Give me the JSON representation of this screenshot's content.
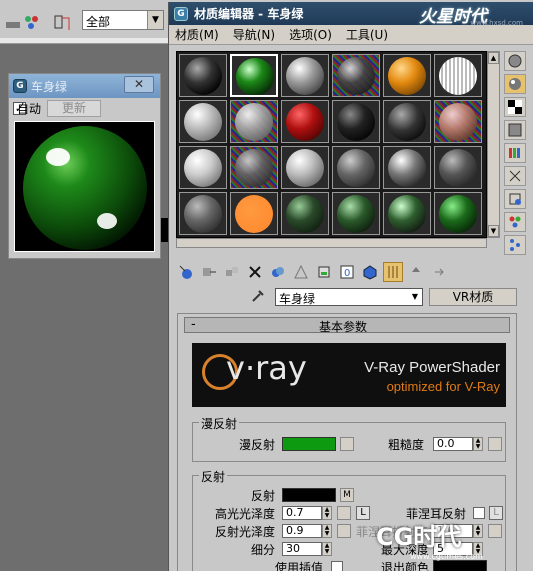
{
  "background": {
    "dropdown_value": "全部"
  },
  "preview_window": {
    "title": "车身绿",
    "auto_label": "自动",
    "update_label": "更新",
    "auto_checked": "✓"
  },
  "material_editor": {
    "title": "材质编辑器 - 车身绿",
    "menu": [
      "材质(M)",
      "导航(N)",
      "选项(O)",
      "工具(U)"
    ],
    "material_name": "车身绿",
    "material_type": "VR材质",
    "rollout_title": "基本参数",
    "vray_banner": {
      "logo": "v·ray",
      "line1": "V-Ray PowerShader",
      "line2": "optimized for V-Ray"
    },
    "diffuse": {
      "group": "漫反射",
      "label": "漫反射",
      "color": "#0e9a10",
      "roughness_label": "粗糙度",
      "roughness": "0.0"
    },
    "reflection": {
      "group": "反射",
      "label": "反射",
      "color": "#000000",
      "map_tag": "M",
      "highlight_gloss_label": "高光光泽度",
      "highlight_gloss": "0.7",
      "l_tag": "L",
      "fresnel_label": "菲涅耳反射",
      "fresnel_l": "L",
      "refl_gloss_label": "反射光泽度",
      "refl_gloss": "0.9",
      "fresnel_ior_label": "菲涅耳折射率",
      "fresnel_ior": "1.6",
      "subdivs_label": "细分",
      "subdivs": "30",
      "max_depth_label": "最大深度",
      "max_depth": "5",
      "use_interp_label": "使用插值",
      "exit_color_label": "退出颜色"
    }
  },
  "watermarks": {
    "top_logo": "火星时代",
    "top_url": "www.hxsd.com",
    "bottom_logo": "CG时代",
    "bottom_url": "www.cgtimes.com"
  },
  "colors": {
    "title_bar": "#1f3a56",
    "vray_orange": "#e07a16",
    "body_green": "#0e9a10"
  }
}
